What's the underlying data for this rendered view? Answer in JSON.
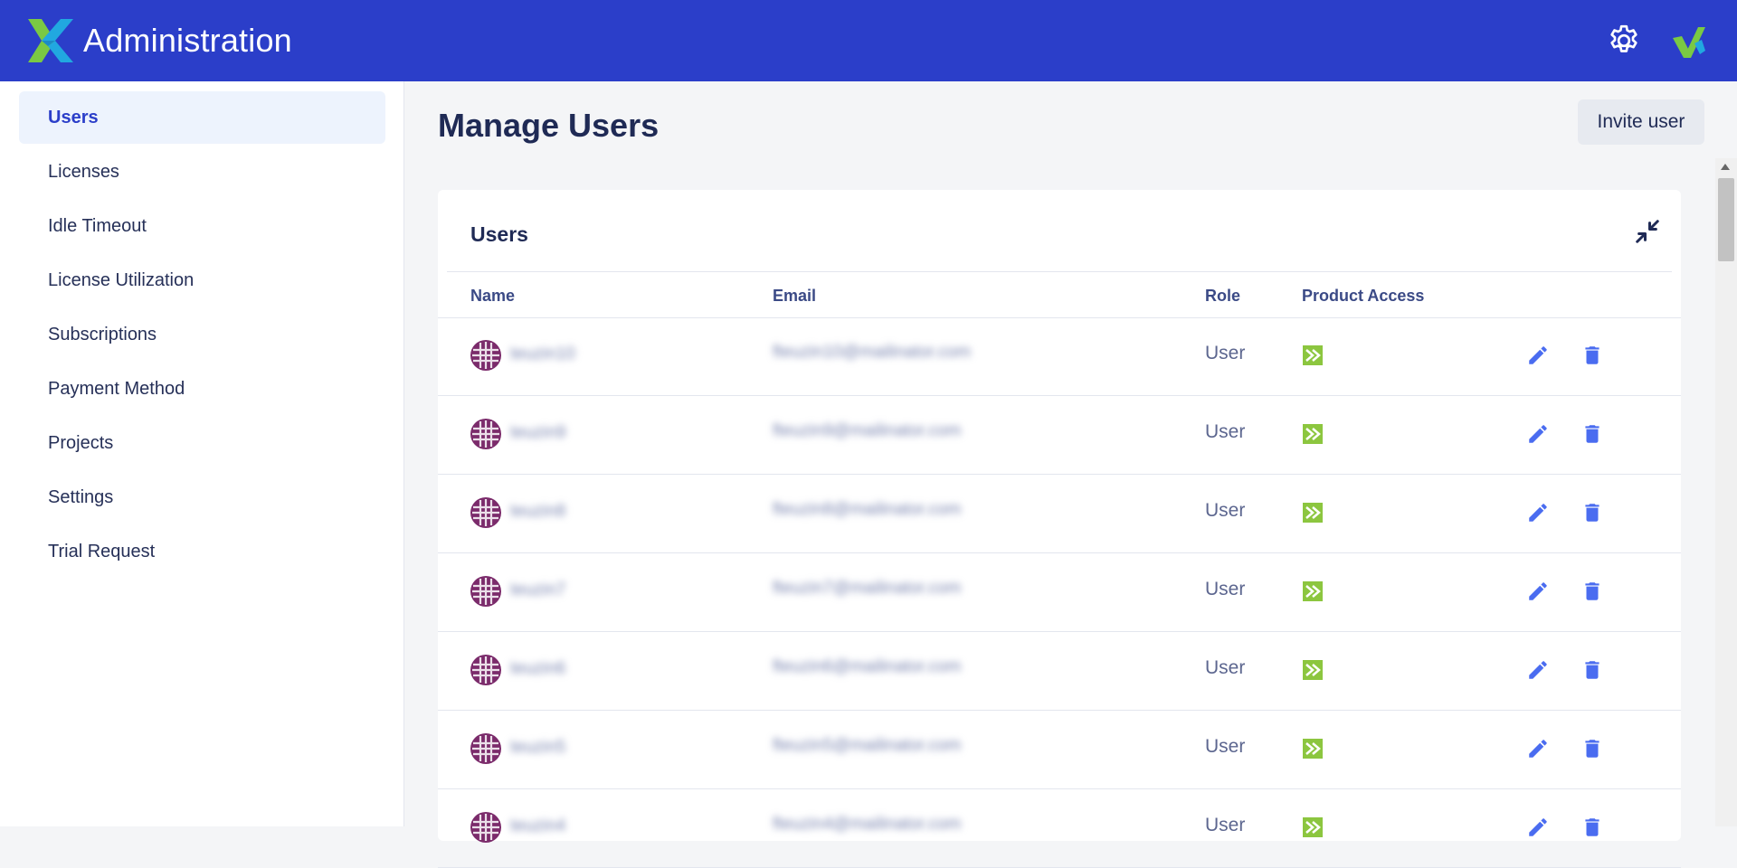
{
  "header": {
    "app_title": "Administration",
    "colors": {
      "bar": "#2b3ec9",
      "logo_green": "#7ac943",
      "logo_blue": "#21a8e0"
    },
    "icons": [
      "x-logo-icon",
      "gear-icon",
      "brand-avatar-icon"
    ]
  },
  "sidebar": {
    "items": [
      {
        "label": "Users",
        "active": true
      },
      {
        "label": "Licenses"
      },
      {
        "label": "Idle Timeout"
      },
      {
        "label": "License Utilization"
      },
      {
        "label": "Subscriptions"
      },
      {
        "label": "Payment Method"
      },
      {
        "label": "Projects"
      },
      {
        "label": "Settings"
      },
      {
        "label": "Trial Request"
      }
    ]
  },
  "main": {
    "page_title": "Manage Users",
    "invite_label": "Invite user",
    "card": {
      "title": "Users",
      "columns": [
        "Name",
        "Email",
        "Role",
        "Product Access"
      ],
      "rows": [
        {
          "name": "teuzin10",
          "email": "fteuzin10@mailinator.com",
          "role": "User"
        },
        {
          "name": "teuzin9",
          "email": "fteuzin9@mailinator.com",
          "role": "User"
        },
        {
          "name": "teuzin8",
          "email": "fteuzin8@mailinator.com",
          "role": "User"
        },
        {
          "name": "teuzin7",
          "email": "fteuzin7@mailinator.com",
          "role": "User"
        },
        {
          "name": "teuzin6",
          "email": "fteuzin6@mailinator.com",
          "role": "User"
        },
        {
          "name": "teuzin5",
          "email": "fteuzin5@mailinator.com",
          "role": "User"
        },
        {
          "name": "teuzin4",
          "email": "fteuzin4@mailinator.com",
          "role": "User"
        }
      ]
    },
    "colors": {
      "action_blue": "#4a6cf0",
      "product_green": "#8cc63f",
      "avatar_purple": "#7b2b6b"
    }
  }
}
